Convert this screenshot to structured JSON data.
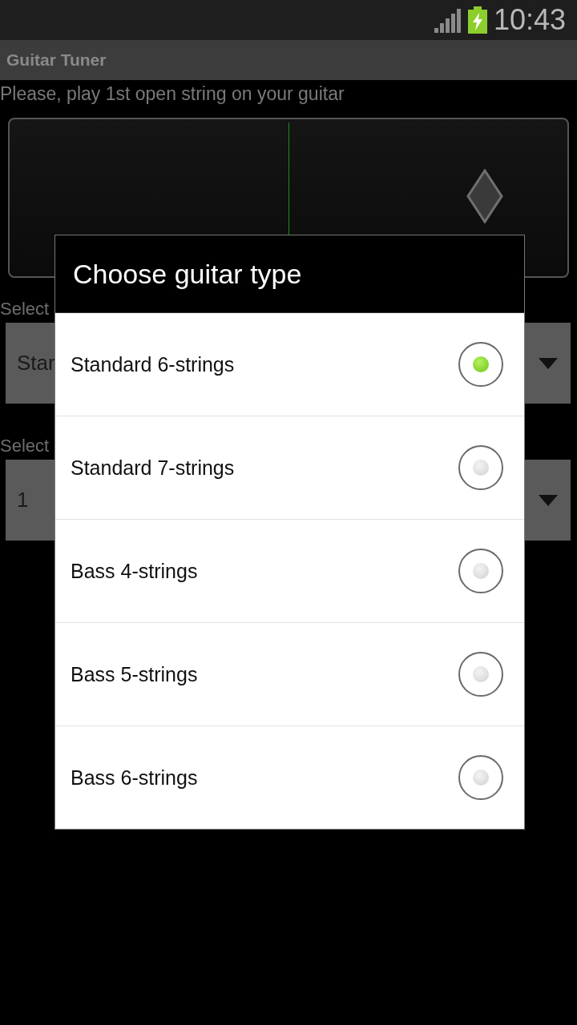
{
  "status_bar": {
    "time": "10:43"
  },
  "app_bar": {
    "title": "Guitar Tuner"
  },
  "prompt": "Please, play 1st open string on your guitar",
  "selectors": [
    {
      "label": "Select",
      "value": "Star"
    },
    {
      "label": "Select",
      "value": "1"
    }
  ],
  "dialog": {
    "title": "Choose guitar type",
    "options": [
      {
        "label": "Standard 6-strings",
        "selected": true
      },
      {
        "label": "Standard 7-strings",
        "selected": false
      },
      {
        "label": "Bass 4-strings",
        "selected": false
      },
      {
        "label": "Bass 5-strings",
        "selected": false
      },
      {
        "label": "Bass 6-strings",
        "selected": false
      }
    ]
  }
}
